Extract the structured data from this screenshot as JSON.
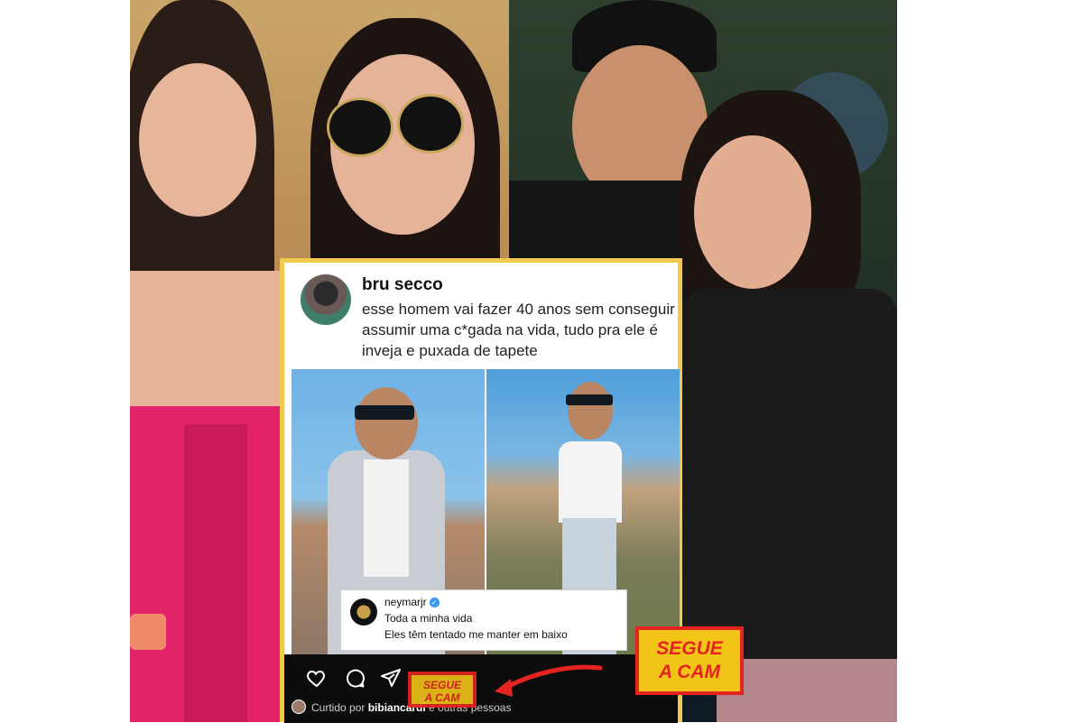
{
  "post": {
    "username": "bru secco",
    "text": "esse homem vai fazer 40 anos sem conseguir assumir uma c*gada na vida, tudo pra ele é inveja e puxada de tapete"
  },
  "comment": {
    "username": "neymarjr",
    "line1": "Toda a minha vida",
    "line2": "Eles têm tentado me manter em baixo"
  },
  "footer": {
    "icons": [
      "heart-icon",
      "comment-icon",
      "share-icon"
    ],
    "liked_prefix": "Curtido por ",
    "liked_user": "bibiancardi",
    "liked_suffix": " e outras pessoas"
  },
  "badge": {
    "line1": "SEGUE",
    "line2": "A CAM"
  },
  "colors": {
    "card_border": "#f2c94c",
    "badge_bg": "#f2c418",
    "badge_text": "#e52421",
    "arrow": "#e52421"
  }
}
